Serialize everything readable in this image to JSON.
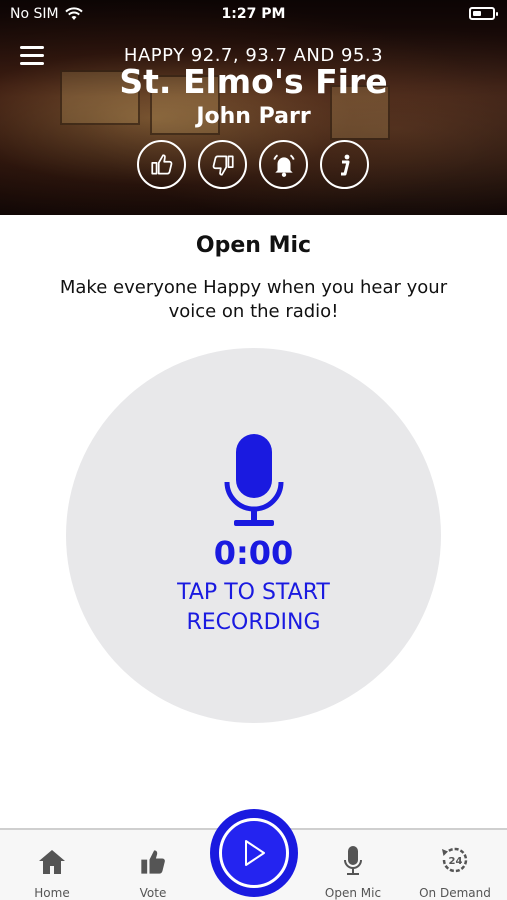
{
  "status_bar": {
    "carrier": "No SIM",
    "time": "1:27 PM",
    "battery_level": 0.45
  },
  "now_playing": {
    "station": "HAPPY 92.7, 93.7 AND 95.3",
    "song": "St. Elmo's Fire",
    "artist": "John Parr"
  },
  "actions": [
    "thumbs-up-icon",
    "thumbs-down-icon",
    "alarm-bell-icon",
    "info-icon"
  ],
  "open_mic": {
    "title": "Open Mic",
    "subtitle": "Make everyone Happy when you hear your voice on the radio!",
    "timer": "0:00",
    "tap_label_line1": "TAP TO START",
    "tap_label_line2": "RECORDING"
  },
  "tabs": {
    "home": "Home",
    "vote": "Vote",
    "open_mic": "Open Mic",
    "on_demand": "On Demand",
    "on_demand_badge": "24"
  },
  "colors": {
    "accent": "#1a1ae0",
    "record_bg": "#e8e8ea"
  }
}
